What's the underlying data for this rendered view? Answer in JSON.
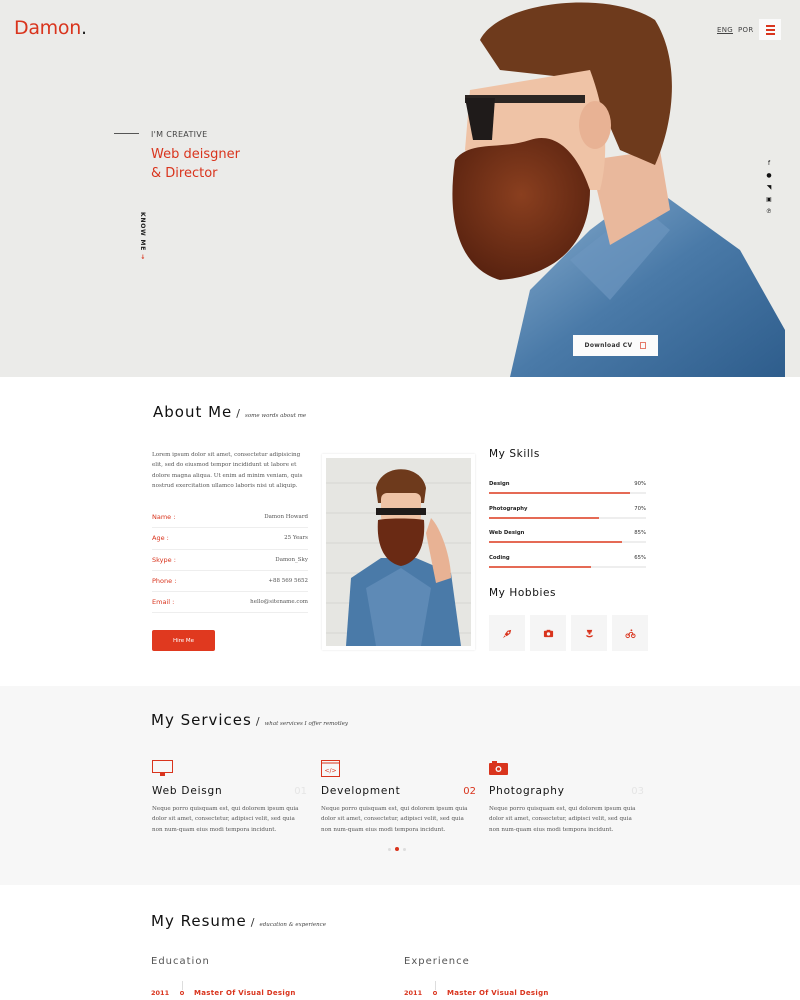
{
  "brand": {
    "name": "Damon",
    "dot": ".",
    "accent": "#d9341d"
  },
  "header": {
    "languages": [
      {
        "code": "ENG",
        "active": true
      },
      {
        "code": "POR",
        "active": false
      }
    ],
    "menu_icon": "hamburger-icon"
  },
  "hero": {
    "eyebrow": "I'M CREATIVE",
    "title_line1": "Web deisgner",
    "title_line2": "& Director",
    "know_me": "KNOW ME",
    "know_me_arrow": "→",
    "social_icons": [
      "facebook-icon",
      "dribbble-icon",
      "twitter-icon",
      "instagram-icon",
      "pinterest-icon"
    ],
    "social_glyphs": [
      "f",
      "●",
      "◥",
      "▣",
      "℗"
    ],
    "download_cv": "Download CV"
  },
  "about": {
    "title": "About Me",
    "subtitle": "some words about me",
    "paragraph": "Lorem ipsum dolor sit amet, consectetur adipisicing elit, sed do eiusmod tempor incididunt ut labore et dolore magna aliqua. Ut enim ad minim veniam, quis nostrud exercitation ullamco laboris nisi ut aliquip.",
    "info": [
      {
        "label": "Name :",
        "value": "Damon Howard"
      },
      {
        "label": "Age :",
        "value": "25 Years"
      },
      {
        "label": "Skype :",
        "value": "Damon_Sky"
      },
      {
        "label": "Phone :",
        "value": "+88 569 5652"
      },
      {
        "label": "Email :",
        "value": "hello@sitename.com"
      }
    ],
    "hire_button": "Hire Me",
    "skills_title": "My Skills",
    "skills": [
      {
        "name": "Design",
        "percent": 90,
        "label": "90%"
      },
      {
        "name": "Photography",
        "percent": 70,
        "label": "70%"
      },
      {
        "name": "Web Design",
        "percent": 85,
        "label": "85%"
      },
      {
        "name": "Coding",
        "percent": 65,
        "label": "65%"
      }
    ],
    "hobbies_title": "My Hobbies",
    "hobbies": [
      "rocket-icon",
      "camera-icon",
      "gaming-icon",
      "cycling-icon"
    ]
  },
  "services": {
    "title": "My Services",
    "subtitle": "what services I offer remotley",
    "items": [
      {
        "title": "Web Deisgn",
        "number": "01",
        "active": false,
        "icon": "monitor-icon",
        "text": "Neque porro quisquam est, qui dolorem ipsum quia dolor sit amet, consectetur, adipisci velit, sed quia non num-quam eius modi tempora incidunt."
      },
      {
        "title": "Development",
        "number": "02",
        "active": true,
        "icon": "code-icon",
        "text": "Neque porro quisquam est, qui dolorem ipsum quia dolor sit amet, consectetur, adipisci velit, sed quia non num-quam eius modi tempora incidunt."
      },
      {
        "title": "Photography",
        "number": "03",
        "active": false,
        "icon": "camera-icon",
        "text": "Neque porro quisquam est, qui dolorem ipsum quia dolor sit amet, consectetur, adipisci velit, sed quia non num-quam eius modi tempora incidunt."
      }
    ],
    "pager": {
      "count": 3,
      "active_index": 1
    }
  },
  "resume": {
    "title": "My Resume",
    "subtitle": "education & experience",
    "education": {
      "title": "Education",
      "items": [
        {
          "year": "2011",
          "title": "Master Of Visual Design"
        }
      ]
    },
    "experience": {
      "title": "Experience",
      "items": [
        {
          "year": "2011",
          "title": "Master Of Visual Design"
        }
      ]
    }
  }
}
